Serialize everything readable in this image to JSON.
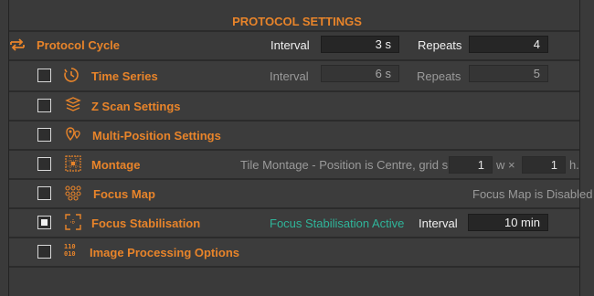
{
  "header": {
    "title": "PROTOCOL SETTINGS"
  },
  "protocol_cycle": {
    "label": "Protocol Cycle",
    "interval_label": "Interval",
    "interval_value": "3 s",
    "repeats_label": "Repeats",
    "repeats_value": "4",
    "icon": "cycle-arrows-icon"
  },
  "rows": {
    "time_series": {
      "label": "Time Series",
      "checked": false,
      "interval_label": "Interval",
      "interval_value": "6 s",
      "repeats_label": "Repeats",
      "repeats_value": "5",
      "icon": "timer-icon"
    },
    "z_scan": {
      "label": "Z Scan Settings",
      "checked": false,
      "icon": "stack-layers-icon"
    },
    "multi_position": {
      "label": "Multi-Position Settings",
      "checked": false,
      "icon": "map-pins-icon"
    },
    "montage": {
      "label": "Montage",
      "checked": false,
      "description": "Tile Montage - Position is Centre, grid size",
      "grid_w": "1",
      "times_label": "w ×",
      "grid_h": "1",
      "suffix": "h.",
      "icon": "grid-tiles-icon"
    },
    "focus_map": {
      "label": "Focus Map",
      "checked": false,
      "status": "Focus Map is Disabled",
      "icon": "dot-network-icon"
    },
    "focus_stabilisation": {
      "label": "Focus Stabilisation",
      "checked": true,
      "status": "Focus Stabilisation Active",
      "interval_label": "Interval",
      "interval_value": "10 min",
      "icon": "focus-corners-icon"
    },
    "image_processing": {
      "label": "Image Processing Options",
      "checked": false,
      "icon_text": [
        "110",
        "010"
      ],
      "icon": "binary-digits-icon"
    }
  },
  "colors": {
    "accent": "#e8842a",
    "active_green": "#2fb59a",
    "background": "#3a3a3a"
  }
}
